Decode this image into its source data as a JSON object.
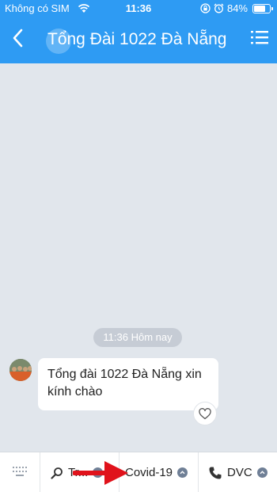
{
  "status_bar": {
    "carrier": "Không có SIM",
    "time": "11:36",
    "battery": "84%",
    "battery_level": 0.84
  },
  "nav": {
    "title": "Tổng Đài 1022 Đà Nẵng"
  },
  "chat": {
    "timestamp": "11:36 Hôm nay",
    "message": "Tổng đài 1022 Đà Nẵng xin kính chào"
  },
  "quick_replies": [
    {
      "label": "Tr...",
      "icon": "search-icon"
    },
    {
      "label": "Covid-19",
      "icon": ""
    },
    {
      "label": "DVC",
      "icon": "phone-icon"
    }
  ],
  "colors": {
    "header": "#2e9bf3",
    "chat_bg": "#e1e6ec",
    "annotation_arrow": "#e0121b"
  }
}
